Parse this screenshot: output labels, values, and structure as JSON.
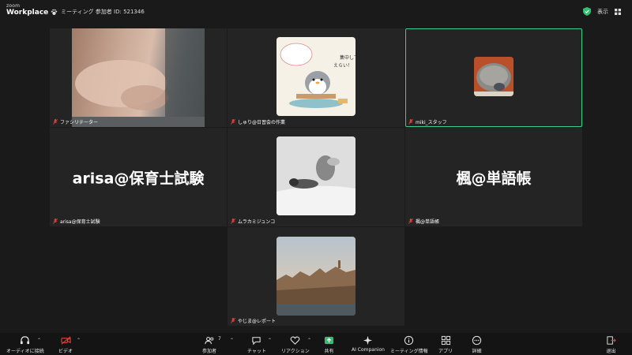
{
  "app": {
    "brand_small": "zoom",
    "brand_name": "Workplace"
  },
  "meeting": {
    "info": "ミーティング 参加者 ID: 521346"
  },
  "topbar": {
    "view_label": "表示"
  },
  "tiles": [
    {
      "name": "ファシリテーター",
      "muted": true
    },
    {
      "name": "しゅり@日習会の作業",
      "muted": true
    },
    {
      "name": "miki_スタッフ",
      "muted": true,
      "active": true
    },
    {
      "name": "arisa@保育士試験",
      "display_name": "arisa@保育士試験",
      "muted": true
    },
    {
      "name": "ムラカミジュンコ",
      "muted": true
    },
    {
      "name": "楓@単語帳",
      "display_name": "楓@単語帳",
      "muted": true
    },
    {
      "name": "やじま@レポート",
      "muted": true
    }
  ],
  "avatar_art": {
    "text1": "集中して",
    "text2": "えらい！"
  },
  "toolbar": {
    "audio": "オーディオに接続",
    "video": "ビデオ",
    "participants": "参加者",
    "participants_count": "7",
    "chat": "チャット",
    "reactions": "リアクション",
    "share": "共有",
    "ai": "AI Companion",
    "meeting_info": "ミーティング情報",
    "apps": "アプリ",
    "details": "詳細",
    "leave": "退出"
  },
  "colors": {
    "active_border": "#3ccf8e",
    "share_green": "#2fbf71",
    "muted_red": "#e0403c",
    "leave_red": "#e0403c"
  }
}
